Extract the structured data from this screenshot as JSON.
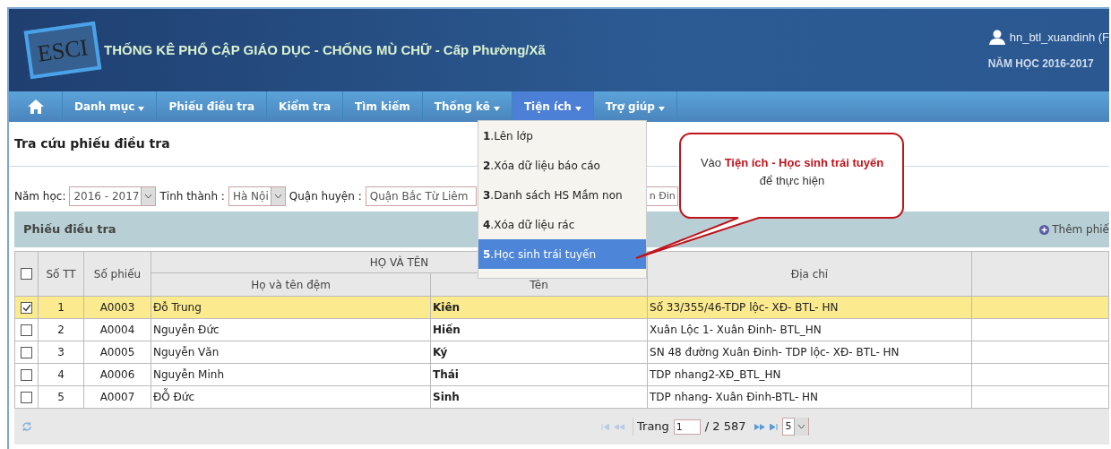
{
  "header": {
    "title": "THỐNG KÊ PHỔ CẬP GIÁO DỤC - CHỐNG MÙ CHỮ - Cấp Phường/Xã",
    "logo": "ESCI",
    "user": "hn_btl_xuandinh (F",
    "school_year": "NĂM HỌC 2016-2017"
  },
  "nav": [
    {
      "label": "Danh mục",
      "dropdown": true,
      "selected": false
    },
    {
      "label": "Phiếu điều tra",
      "dropdown": false,
      "selected": false
    },
    {
      "label": "Kiểm tra",
      "dropdown": false,
      "selected": false
    },
    {
      "label": "Tìm kiếm",
      "dropdown": false,
      "selected": false
    },
    {
      "label": "Thống kê",
      "dropdown": true,
      "selected": false
    },
    {
      "label": "Tiện ích",
      "dropdown": true,
      "selected": true
    },
    {
      "label": "Trợ giúp",
      "dropdown": true,
      "selected": false
    }
  ],
  "page_title": "Tra cứu phiếu điều tra",
  "filters": [
    {
      "label": "Năm học:",
      "value": "2016 - 2017",
      "kind": "select"
    },
    {
      "label": "Tỉnh thành :",
      "value": "Hà Nội",
      "kind": "select"
    },
    {
      "label": "Quận huyện :",
      "value": "Quận Bắc Từ Liêm",
      "kind": "field"
    },
    {
      "value": "n Đin",
      "kind": "field"
    }
  ],
  "dropdown_menu": [
    {
      "label": "**1**.Lên lớp",
      "selected": false
    },
    {
      "label": "**2**.Xóa dữ liệu báo cáo",
      "selected": false
    },
    {
      "label": "**3**.Danh sách HS Mầm non",
      "selected": false
    },
    {
      "label": "**4**.Xóa dữ liệu rác",
      "selected": false
    },
    {
      "label": "**5**.Học sinh trái tuyến",
      "selected": true
    }
  ],
  "callout": {
    "text": "Vào **Tiện ích - Học sinh trái tuyến**",
    "note": "để thực hiện"
  },
  "panel": {
    "title": "Phiếu điều tra",
    "add_button": "Thêm phiế"
  },
  "table": {
    "select_all_checked": false,
    "group_header": "HỌ VÀ TÊN",
    "columns": [
      "Số TT",
      "Số phiếu",
      "Họ và tên đệm",
      "Tên",
      "Địa chỉ"
    ],
    "rows": [
      {
        "no": "1",
        "code": "A0003",
        "middle": "Đỗ Trung",
        "name": "Kiên",
        "address": "Số 33/355/46-TDP lộc- XĐ- BTL- HN",
        "checked": true,
        "selected": true
      },
      {
        "no": "2",
        "code": "A0004",
        "middle": "Nguyễn Đức",
        "name": "Hiến",
        "address": "Xuân Lộc 1- Xuân Đinh- BTL_HN",
        "checked": false,
        "selected": false
      },
      {
        "no": "3",
        "code": "A0005",
        "middle": "Nguyễn Văn",
        "name": "Ký",
        "address": "SN 48 đường Xuân Đinh- TDP lộc- XĐ- BTL- HN",
        "checked": false,
        "selected": false
      },
      {
        "no": "4",
        "code": "A0006",
        "middle": "Nguyễn Minh",
        "name": "Thái",
        "address": "TDP nhang2-XĐ_BTL_HN",
        "checked": false,
        "selected": false
      },
      {
        "no": "5",
        "code": "A0007",
        "middle": "ĐỖ Đức",
        "name": "Sinh",
        "address": "TDP nhang- Xuân Đinh-BTL- HN",
        "checked": false,
        "selected": false
      }
    ]
  },
  "pager": {
    "page_label": "Trang",
    "page": "1",
    "total": "/ 2 587",
    "page_size": "5"
  }
}
